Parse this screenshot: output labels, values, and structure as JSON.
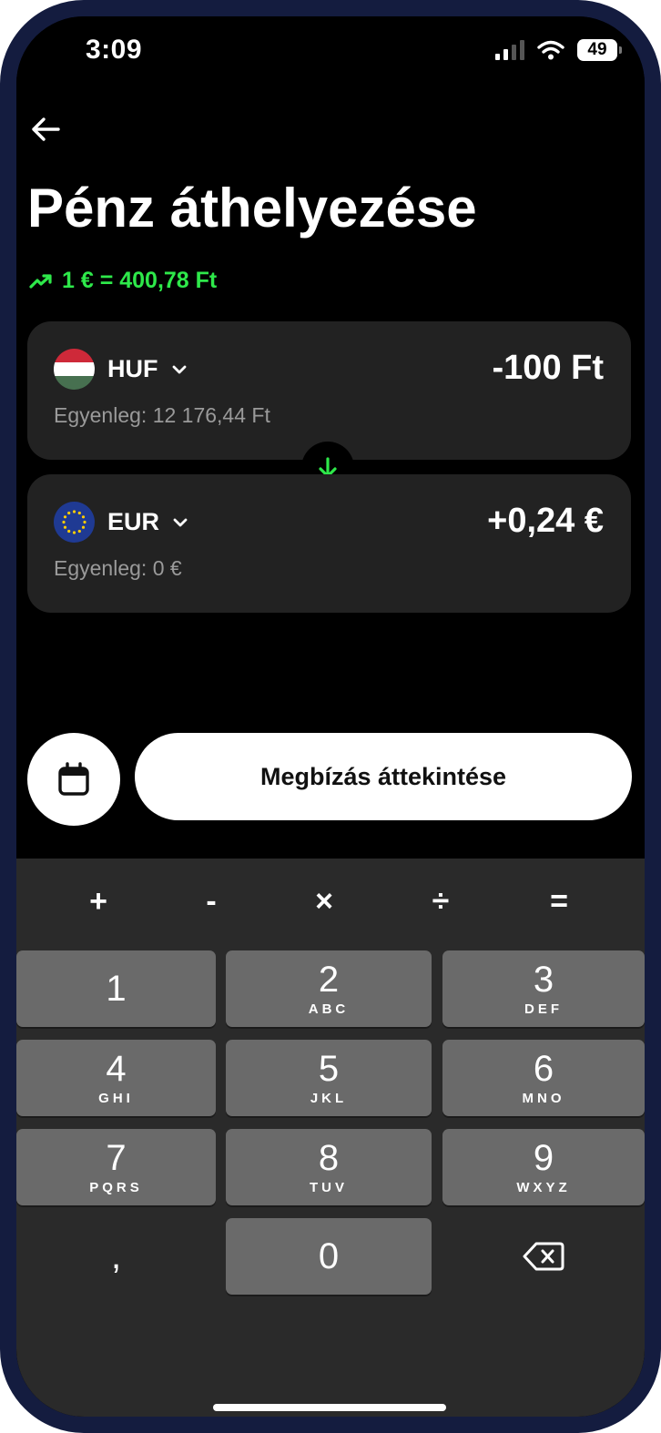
{
  "status": {
    "time": "3:09",
    "battery": "49",
    "icons": [
      "cellular-signal-icon",
      "wifi-icon",
      "battery-icon"
    ]
  },
  "header": {
    "back_icon": "arrow-left-icon",
    "title": "Pénz áthelyezése",
    "rate": "1 € = 400,78 Ft",
    "rate_icon": "trend-up-icon"
  },
  "from": {
    "currency": "HUF",
    "flag": "hungary-flag",
    "amount": "-100 Ft",
    "balance": "Egyenleg: 12 176,44 Ft"
  },
  "to": {
    "currency": "EUR",
    "flag": "eu-flag",
    "amount": "+0,24 €",
    "balance": "Egyenleg: 0 €"
  },
  "actions": {
    "calendar_icon": "calendar-icon",
    "review_label": "Megbízás áttekintése"
  },
  "keypad": {
    "ops": [
      "+",
      "-",
      "×",
      "÷",
      "="
    ],
    "keys": [
      {
        "num": "1",
        "letters": ""
      },
      {
        "num": "2",
        "letters": "ABC"
      },
      {
        "num": "3",
        "letters": "DEF"
      },
      {
        "num": "4",
        "letters": "GHI"
      },
      {
        "num": "5",
        "letters": "JKL"
      },
      {
        "num": "6",
        "letters": "MNO"
      },
      {
        "num": "7",
        "letters": "PQRS"
      },
      {
        "num": "8",
        "letters": "TUV"
      },
      {
        "num": "9",
        "letters": "WXYZ"
      }
    ],
    "comma": ",",
    "zero": "0",
    "backspace_icon": "backspace-icon"
  },
  "colors": {
    "accent_green": "#2ee84a",
    "card_bg": "#222222",
    "frame": "#141c3f",
    "keypad_bg": "#2a2a2a",
    "key_bg": "#6a6a6a"
  }
}
